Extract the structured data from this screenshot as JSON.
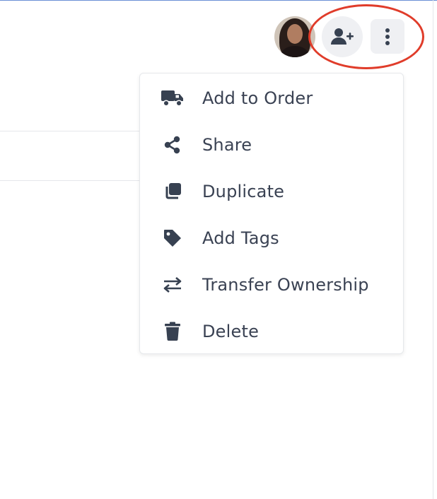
{
  "header": {
    "avatar_icon": "user-avatar-photo",
    "add_person_icon": "user-plus-icon",
    "more_icon": "vertical-ellipsis-icon"
  },
  "menu": {
    "items": [
      {
        "label": "Add to Order",
        "icon": "truck-icon"
      },
      {
        "label": "Share",
        "icon": "share-icon"
      },
      {
        "label": "Duplicate",
        "icon": "duplicate-icon"
      },
      {
        "label": "Add Tags",
        "icon": "tag-icon"
      },
      {
        "label": "Transfer Ownership",
        "icon": "transfer-arrows-icon"
      },
      {
        "label": "Delete",
        "icon": "trash-icon"
      }
    ]
  },
  "colors": {
    "icon": "#374151",
    "text": "#3a4253",
    "button_bg": "#eff0f3",
    "highlight": "#e03c2a"
  }
}
